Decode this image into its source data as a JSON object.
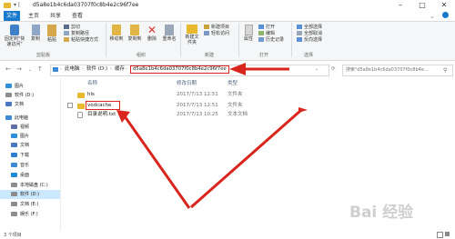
{
  "window": {
    "title": "d5a8e1b4c6da03707f0c8b4e2c96f7ee",
    "qat_label": "▾ |"
  },
  "ribbon_tabs": [
    "文件",
    "主页",
    "共享",
    "查看"
  ],
  "ribbon": {
    "pin_label": "固定到\"快速访问\"",
    "copy_label": "复制",
    "paste_label": "粘贴",
    "cut_label": "剪切",
    "copy_path_label": "复制路径",
    "paste_shortcut_label": "粘贴快捷方式",
    "move_to_label": "移动到",
    "copy_to_label": "复制到",
    "delete_label": "删除",
    "rename_label": "重命名",
    "new_folder_label": "新建文件夹",
    "new_item_label": "新建项目",
    "easy_access_label": "轻松访问",
    "properties_label": "属性",
    "open_label": "打开",
    "edit_label": "编辑",
    "history_label": "历史记录",
    "select_all_label": "全部选择",
    "select_none_label": "全部取消",
    "invert_label": "反向选择",
    "group_clipboard": "剪贴板",
    "group_organize": "组织",
    "group_new": "新建",
    "group_open": "打开",
    "group_select": "选择"
  },
  "address": {
    "crumbs": [
      "此电脑",
      "软件 (D:)",
      "缓存"
    ],
    "current": "d5a8e1b4c6da03707f0c8b4e2c96f7ee",
    "search_placeholder": "搜索\"d5a8e1b4c6da03707f0c8b4e..."
  },
  "sidebar": {
    "items": [
      {
        "label": "图片",
        "color": "#2f8fd8"
      },
      {
        "label": "软件 (D:)",
        "color": "#8c8c8c"
      },
      {
        "label": "文档",
        "color": "#4a78c2"
      },
      {
        "label": "此电脑",
        "color": "#3a8ad6"
      },
      {
        "label": "视频",
        "color": "#5f6ea8"
      },
      {
        "label": "图片",
        "color": "#2f8fd8"
      },
      {
        "label": "文档",
        "color": "#4a78c2"
      },
      {
        "label": "下载",
        "color": "#2f7fd0"
      },
      {
        "label": "音乐",
        "color": "#3a8ad6"
      },
      {
        "label": "桌面",
        "color": "#1f8ad6"
      },
      {
        "label": "本地磁盘 (C:)",
        "color": "#8c8c8c"
      },
      {
        "label": "软件 (D:)",
        "color": "#8c8c8c"
      },
      {
        "label": "文档 (E:)",
        "color": "#8c8c8c"
      },
      {
        "label": "娱乐 (F:)",
        "color": "#8c8c8c"
      }
    ]
  },
  "columns": {
    "name": "名称",
    "date": "修改日期",
    "type": "类型"
  },
  "files": [
    {
      "name": "hls",
      "date": "2017/7/13 12:51",
      "type": "文件夹",
      "kind": "folder"
    },
    {
      "name": "vodcache",
      "date": "2017/7/13 12:51",
      "type": "文件夹",
      "kind": "folder"
    },
    {
      "name": "目录说明.txt",
      "date": "2017/7/13 10:25",
      "type": "文本文档",
      "kind": "txt"
    }
  ],
  "statusbar": {
    "count": "3 个项目"
  },
  "watermark": "Bai 经验"
}
